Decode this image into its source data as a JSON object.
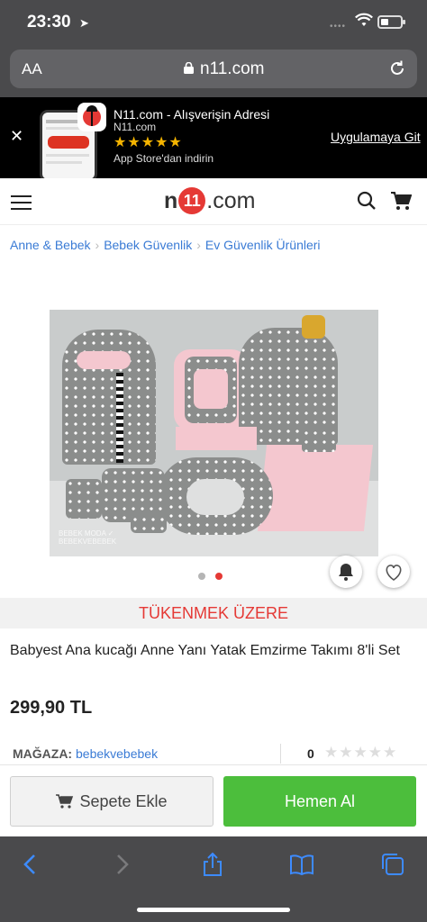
{
  "status": {
    "time": "23:30",
    "signal_text": "••••"
  },
  "browser": {
    "aa_label": "AA",
    "domain": "n11.com"
  },
  "app_banner": {
    "title": "N11.com - Alışverişin Adresi",
    "subtitle": "N11.com",
    "stars": "★★★★★",
    "store_text": "App Store'dan indirin",
    "cta": "Uygulamaya Git",
    "close": "✕"
  },
  "header": {
    "logo_n": "n",
    "logo_ones": "11",
    "logo_com": ".com"
  },
  "breadcrumb": [
    "Anne & Bebek",
    "Bebek Güvenlik",
    "Ev Güvenlik Ürünleri"
  ],
  "breadcrumb_sep": "›",
  "image_watermark": "BEBEK MODA ✓\nBEBEKVEBEBEK",
  "carousel": {
    "count": 2,
    "active": 2
  },
  "stock_label": "TÜKENMEK ÜZERE",
  "product": {
    "title": "Babyest Ana kucağı Anne Yanı Yatak Emzirme Takımı 8'li Set",
    "price": "299,90 TL"
  },
  "store": {
    "label": "MAĞAZA:",
    "name": "bebekvebebek",
    "score": "0",
    "stars": "★★★★★"
  },
  "actions": {
    "add_to_cart": "Sepete Ekle",
    "buy_now": "Hemen Al"
  },
  "colors": {
    "accent_red": "#e53935",
    "buy_green": "#4cbe3c",
    "link_blue": "#3a7bd5"
  }
}
